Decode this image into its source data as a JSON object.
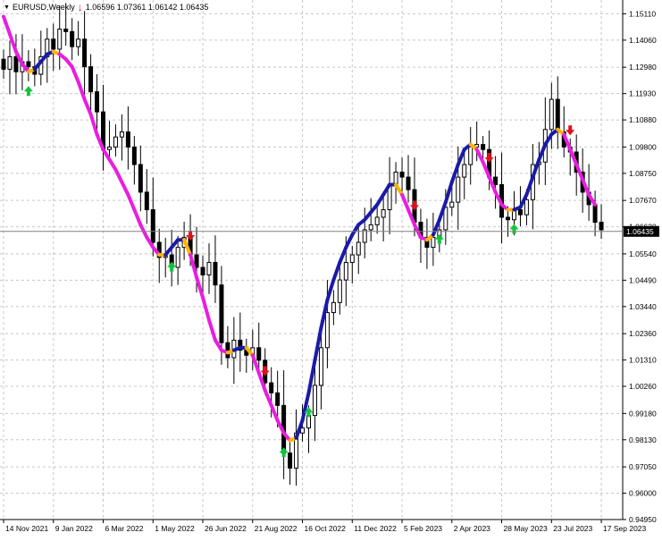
{
  "header": {
    "symbol": "EURUSD,Weekly",
    "values": "1.06596 1.07361 1.06142 1.06435"
  },
  "colors": {
    "background": "#ffffff",
    "grid": "#c8c8c8",
    "candle": "#000000",
    "ma_up": "#1a1aa8",
    "ma_down": "#e81ee0",
    "ma_transition": "#ffb400",
    "signal_buy": "#10c43c",
    "signal_sell": "#e0101a",
    "price_label_bg": "#000000",
    "price_label_text": "#ffffff"
  },
  "chart_data": {
    "type": "candlestick",
    "symbol": "EURUSD",
    "timeframe": "Weekly",
    "last_ohlc": {
      "open": 1.06596,
      "high": 1.07361,
      "low": 1.06142,
      "close": 1.06435
    },
    "current_price_label": "1.06435",
    "y_ticks": [
      "1.15110",
      "1.14060",
      "1.12980",
      "1.11930",
      "1.10880",
      "1.09800",
      "1.08750",
      "1.07670",
      "1.06620",
      "1.05540",
      "1.04490",
      "1.03440",
      "1.02360",
      "1.01310",
      "1.00260",
      "0.99180",
      "0.98130",
      "0.97050",
      "0.96000",
      "0.94950"
    ],
    "ylim": [
      0.9495,
      1.1566
    ],
    "x_ticks": [
      "14 Nov 2021",
      "9 Jan 2022",
      "6 Mar 2022",
      "1 May 2022",
      "26 Jun 2022",
      "21 Aug 2022",
      "16 Oct 2022",
      "11 Dec 2022",
      "5 Feb 2023",
      "2 Apr 2023",
      "28 May 2023",
      "23 Jul 2023",
      "17 Sep 2023"
    ],
    "x_tick_index": [
      0,
      8,
      16,
      24,
      32,
      40,
      48,
      56,
      64,
      72,
      80,
      88,
      96
    ],
    "x_range": [
      0,
      98
    ],
    "grid": true,
    "closes": [
      1.129,
      1.134,
      1.128,
      1.132,
      1.13,
      1.127,
      1.134,
      1.141,
      1.137,
      1.145,
      1.144,
      1.138,
      1.141,
      1.13,
      1.12,
      1.112,
      1.097,
      1.098,
      1.102,
      1.104,
      1.098,
      1.091,
      1.08,
      1.073,
      1.06,
      1.054,
      1.055,
      1.05,
      1.058,
      1.062,
      1.055,
      1.05,
      1.047,
      1.052,
      1.043,
      1.02,
      1.014,
      1.021,
      1.017,
      1.015,
      1.018,
      1.013,
      1.004,
      1.0,
      0.995,
      0.976,
      0.97,
      0.984,
      0.986,
      0.991,
      1.003,
      1.018,
      1.032,
      1.036,
      1.045,
      1.052,
      1.055,
      1.06,
      1.065,
      1.067,
      1.07,
      1.073,
      1.083,
      1.088,
      1.086,
      1.081,
      1.068,
      1.062,
      1.058,
      1.062,
      1.065,
      1.074,
      1.076,
      1.086,
      1.091,
      1.098,
      1.099,
      1.097,
      1.086,
      1.083,
      1.07,
      1.069,
      1.073,
      1.071,
      1.077,
      1.091,
      1.092,
      1.105,
      1.117,
      1.104,
      1.098,
      1.096,
      1.088,
      1.08,
      1.075,
      1.068,
      1.065
    ],
    "ma": [
      1.15,
      1.143,
      1.136,
      1.131,
      1.128,
      1.129,
      1.132,
      1.135,
      1.136,
      1.135,
      1.133,
      1.13,
      1.124,
      1.117,
      1.111,
      1.103,
      1.097,
      1.093,
      1.089,
      1.084,
      1.079,
      1.073,
      1.067,
      1.062,
      1.058,
      1.055,
      1.055,
      1.058,
      1.061,
      1.061,
      1.055,
      1.046,
      1.038,
      1.029,
      1.021,
      1.017,
      1.016,
      1.017,
      1.018,
      1.018,
      1.015,
      1.008,
      1.001,
      0.995,
      0.989,
      0.984,
      0.981,
      0.982,
      0.989,
      1.0,
      1.013,
      1.026,
      1.037,
      1.045,
      1.052,
      1.058,
      1.063,
      1.067,
      1.069,
      1.072,
      1.075,
      1.079,
      1.083,
      1.083,
      1.079,
      1.073,
      1.067,
      1.062,
      1.061,
      1.063,
      1.069,
      1.076,
      1.084,
      1.091,
      1.097,
      1.099,
      1.097,
      1.092,
      1.086,
      1.08,
      1.075,
      1.073,
      1.073,
      1.074,
      1.079,
      1.086,
      1.093,
      1.099,
      1.103,
      1.105,
      1.103,
      1.097,
      1.091,
      1.085,
      1.079,
      1.075
    ],
    "buy_signals": [
      4,
      27,
      45,
      49,
      70,
      82
    ],
    "sell_signals": [
      30,
      42,
      66,
      78,
      91
    ],
    "top_sell_marker": [
      11
    ]
  }
}
